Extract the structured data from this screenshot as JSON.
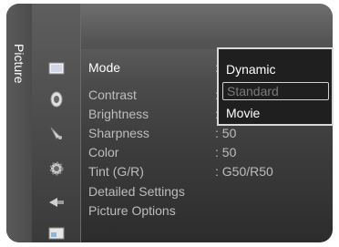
{
  "menu": {
    "category": "Picture",
    "icons": [
      "picture-icon",
      "sound-icon",
      "channel-icon",
      "setup-icon",
      "input-icon",
      "application-icon"
    ],
    "items": [
      {
        "label": "Mode",
        "value": ":"
      },
      {
        "label": "Contrast",
        "value": ":"
      },
      {
        "label": "Brightness",
        "value": ":"
      },
      {
        "label": "Sharpness",
        "value": ": 50"
      },
      {
        "label": "Color",
        "value": ": 50"
      },
      {
        "label": "Tint (G/R)",
        "value": ": G50/R50"
      },
      {
        "label": "Detailed Settings",
        "value": ""
      },
      {
        "label": "Picture Options",
        "value": ""
      }
    ]
  },
  "dropdown": {
    "options": [
      "Dynamic",
      "Standard",
      "Movie"
    ],
    "disabled": "Standard"
  }
}
